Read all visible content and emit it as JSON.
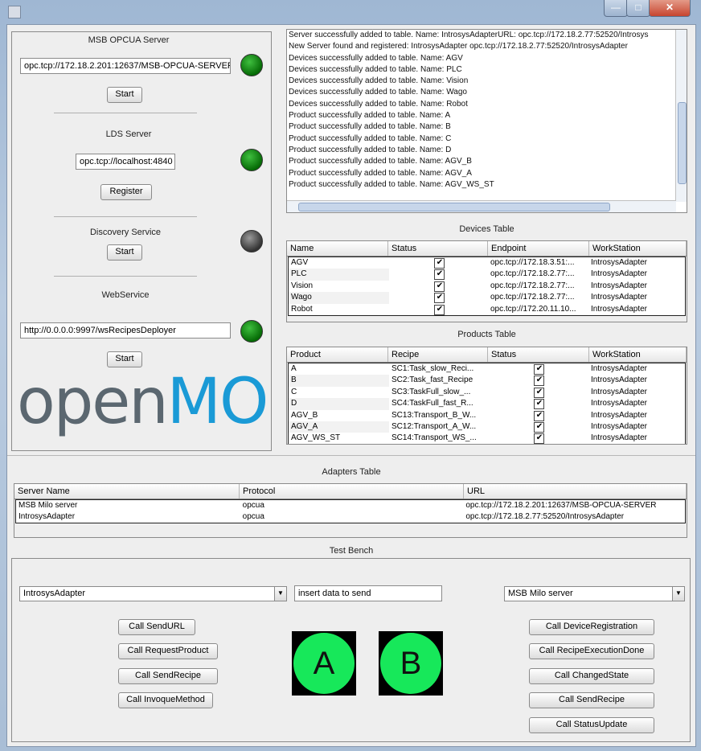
{
  "window": {
    "controls": {
      "minimize": "—",
      "maximize": "□",
      "close": "✕"
    }
  },
  "msb_opcua": {
    "title": "MSB OPCUA Server",
    "url": "opc.tcp://172.18.2.201:12637/MSB-OPCUA-SERVER",
    "button": "Start",
    "status_color": "#0b7d0b"
  },
  "lds": {
    "title": "LDS Server",
    "url": "opc.tcp://localhost:4840",
    "button": "Register",
    "status_color": "#0b7d0b"
  },
  "discovery": {
    "title": "Discovery Service",
    "button": "Start",
    "status_color": "#555555"
  },
  "webservice": {
    "title": "WebService",
    "url": "http://0.0.0.0:9997/wsRecipesDeployer",
    "button": "Start",
    "status_color": "#0b7d0b"
  },
  "logo": {
    "part1": "open",
    "part2": "MOS",
    "color1": "#5b6770",
    "color2": "#1a9ad6"
  },
  "log_lines": [
    "Server successfully added to table. Name: IntrosysAdapterURL: opc.tcp://172.18.2.77:52520/Introsys",
    "New Server found and registered: IntrosysAdapter opc.tcp://172.18.2.77:52520/IntrosysAdapter",
    "Devices successfully added to table. Name: AGV",
    "Devices successfully added to table. Name: PLC",
    "Devices successfully added to table. Name: Vision",
    "Devices successfully added to table. Name: Wago",
    "Devices successfully added to table. Name: Robot",
    "Product successfully added to table. Name: A",
    "Product successfully added to table. Name: B",
    "Product successfully added to table. Name: C",
    "Product successfully added to table. Name: D",
    "Product successfully added to table. Name: AGV_B",
    "Product successfully added to table. Name: AGV_A",
    "Product successfully added to table. Name: AGV_WS_ST"
  ],
  "devices_table": {
    "title": "Devices Table",
    "columns": [
      "Name",
      "Status",
      "Endpoint",
      "WorkStation"
    ],
    "rows": [
      [
        "AGV",
        "✔",
        "opc.tcp://172.18.3.51:...",
        "IntrosysAdapter"
      ],
      [
        "PLC",
        "✔",
        "opc.tcp://172.18.2.77:...",
        "IntrosysAdapter"
      ],
      [
        "Vision",
        "✔",
        "opc.tcp://172.18.2.77:...",
        "IntrosysAdapter"
      ],
      [
        "Wago",
        "✔",
        "opc.tcp://172.18.2.77:...",
        "IntrosysAdapter"
      ],
      [
        "Robot",
        "✔",
        "opc.tcp://172.20.11.10...",
        "IntrosysAdapter"
      ]
    ]
  },
  "products_table": {
    "title": "Products Table",
    "columns": [
      "Product",
      "Recipe",
      "Status",
      "WorkStation"
    ],
    "rows": [
      [
        "A",
        "SC1:Task_slow_Reci...",
        "✔",
        "IntrosysAdapter"
      ],
      [
        "B",
        "SC2:Task_fast_Recipe",
        "✔",
        "IntrosysAdapter"
      ],
      [
        "C",
        "SC3:TaskFull_slow_...",
        "✔",
        "IntrosysAdapter"
      ],
      [
        "D",
        "SC4:TaskFull_fast_R...",
        "✔",
        "IntrosysAdapter"
      ],
      [
        "AGV_B",
        "SC13:Transport_B_W...",
        "✔",
        "IntrosysAdapter"
      ],
      [
        "AGV_A",
        "SC12:Transport_A_W...",
        "✔",
        "IntrosysAdapter"
      ],
      [
        "AGV_WS_ST",
        "SC14:Transport_WS_...",
        "✔",
        "IntrosysAdapter"
      ]
    ]
  },
  "adapters_table": {
    "title": "Adapters Table",
    "columns": [
      "Server Name",
      "Protocol",
      "URL"
    ],
    "rows": [
      [
        "MSB Milo server",
        "opcua",
        "opc.tcp://172.18.2.201:12637/MSB-OPCUA-SERVER"
      ],
      [
        "IntrosysAdapter",
        "opcua",
        "opc.tcp://172.18.2.77:52520/IntrosysAdapter"
      ]
    ]
  },
  "test_bench": {
    "title": "Test Bench",
    "left_combo": "IntrosysAdapter",
    "data_input": "insert data to send",
    "right_combo": "MSB Milo server",
    "left_buttons": [
      "Call SendURL",
      "Call RequestProduct",
      "Call SendRecipe",
      "Call InvoqueMethod"
    ],
    "right_buttons": [
      "Call DeviceRegistration",
      "Call RecipeExecutionDone",
      "Call ChangedState",
      "Call SendRecipe",
      "Call StatusUpdate"
    ],
    "button_a": "A",
    "button_b": "B",
    "indicator_color": "#17e85a"
  }
}
